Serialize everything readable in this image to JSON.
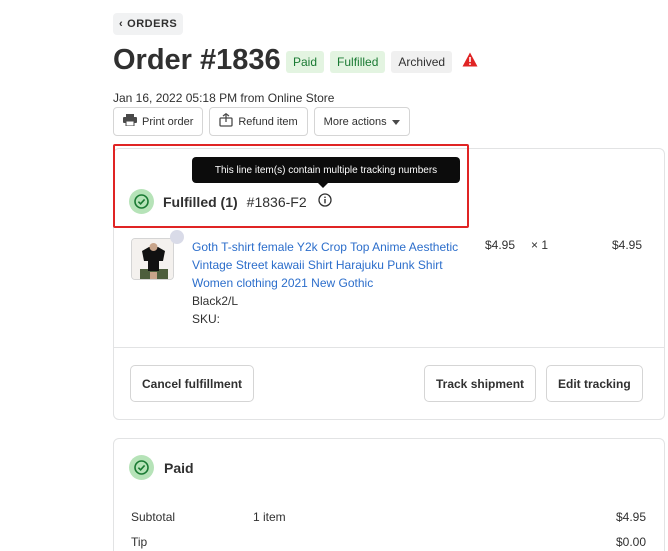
{
  "nav": {
    "back_label": "ORDERS"
  },
  "order": {
    "title": "Order #1836",
    "badges": {
      "paid": "Paid",
      "fulfilled": "Fulfilled",
      "archived": "Archived"
    },
    "subline": "Jan 16, 2022 05:18 PM from Online Store"
  },
  "actions": {
    "print": "Print order",
    "refund": "Refund item",
    "more": "More actions"
  },
  "tooltip": "This line item(s) contain multiple tracking numbers",
  "fulfillment": {
    "title": "Fulfilled (1)",
    "code": "#1836-F2",
    "item": {
      "name_lines": [
        "Goth T-shirt female Y2k Crop Top Anime Aesthetic",
        "Vintage Street kawaii Shirt Harajuku Punk Shirt",
        "Women clothing 2021 New Gothic"
      ],
      "variant": "Black2/L",
      "sku": "SKU:",
      "price": "$4.95",
      "qty": "× 1",
      "total": "$4.95"
    },
    "buttons": {
      "cancel": "Cancel fulfillment",
      "track": "Track shipment",
      "edit": "Edit tracking"
    }
  },
  "payment": {
    "title": "Paid",
    "rows": [
      {
        "label": "Subtotal",
        "mid": "1 item",
        "amount": "$4.95"
      },
      {
        "label": "Tip",
        "mid": "",
        "amount": "$0.00"
      }
    ]
  },
  "colors": {
    "link": "#2c6ecb",
    "success_bg": "#b6e3b8",
    "highlight": "#e02424",
    "warning": "#e02424"
  },
  "icons": [
    "chevron-left-icon",
    "warning-icon",
    "printer-icon",
    "refund-icon",
    "chevron-down-icon",
    "check-circle-icon",
    "info-icon"
  ]
}
